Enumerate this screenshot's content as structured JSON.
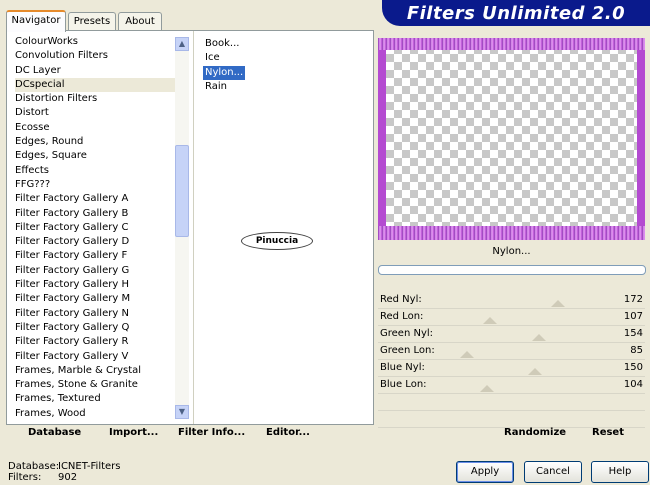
{
  "tabs": [
    "Navigator",
    "Presets",
    "About"
  ],
  "banner_title": "Filters Unlimited 2.0",
  "categories": [
    "ColourWorks",
    "Convolution Filters",
    "DC Layer",
    "DCspecial",
    "Distortion Filters",
    "Distort",
    "Ecosse",
    "Edges, Round",
    "Edges, Square",
    "Effects",
    "FFG???",
    "Filter Factory Gallery A",
    "Filter Factory Gallery B",
    "Filter Factory Gallery C",
    "Filter Factory Gallery D",
    "Filter Factory Gallery F",
    "Filter Factory Gallery G",
    "Filter Factory Gallery H",
    "Filter Factory Gallery M",
    "Filter Factory Gallery N",
    "Filter Factory Gallery Q",
    "Filter Factory Gallery R",
    "Filter Factory Gallery V",
    "Frames, Marble & Crystal",
    "Frames, Stone & Granite",
    "Frames, Textured",
    "Frames, Wood"
  ],
  "selected_category": "DCspecial",
  "filters": [
    "Book...",
    "Ice",
    "Nylon...",
    "Rain"
  ],
  "selected_filter": "Nylon...",
  "watermark": "Pinuccia",
  "filter_name": "Nylon...",
  "params": [
    {
      "label": "Red Nyl:",
      "value": "172",
      "level": 0.675
    },
    {
      "label": "Red Lon:",
      "value": "107",
      "level": 0.42
    },
    {
      "label": "Green Nyl:",
      "value": "154",
      "level": 0.604
    },
    {
      "label": "Green Lon:",
      "value": "85",
      "level": 0.333
    },
    {
      "label": "Blue Nyl:",
      "value": "150",
      "level": 0.588
    },
    {
      "label": "Blue Lon:",
      "value": "104",
      "level": 0.408
    }
  ],
  "left_buttons": [
    "Database",
    "Import...",
    "Filter Info...",
    "Editor..."
  ],
  "randomize": "Randomize",
  "reset": "Reset",
  "status": {
    "database_label": "Database:",
    "database_value": "ICNET-Filters",
    "filters_label": "Filters:",
    "filters_value": "902"
  },
  "dialog_buttons": {
    "apply": "Apply",
    "cancel": "Cancel",
    "help": "Help"
  },
  "colors": {
    "banner": "#0a1a8c",
    "selection": "#316ac5",
    "frame": "#b44bd1"
  }
}
